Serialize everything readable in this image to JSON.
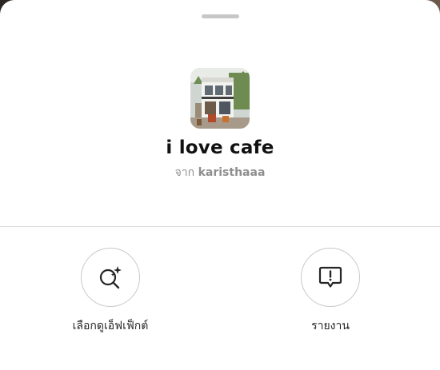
{
  "effect": {
    "name": "i love cafe",
    "byline_prefix": "จาก",
    "creator": "karisthaaa",
    "thumbnail_icon": "cafe-photo"
  },
  "actions": [
    {
      "label": "เลือกดูเอ็ฟเฟ็กต์",
      "icon": "search-sparkle-icon"
    },
    {
      "label": "รายงาน",
      "icon": "report-icon"
    }
  ],
  "colors": {
    "sheet_background": "#ffffff",
    "primary_text": "#111111",
    "secondary_text": "#8e8e8e",
    "divider": "#dbdbdb",
    "circle_border": "#c8c8c8"
  }
}
